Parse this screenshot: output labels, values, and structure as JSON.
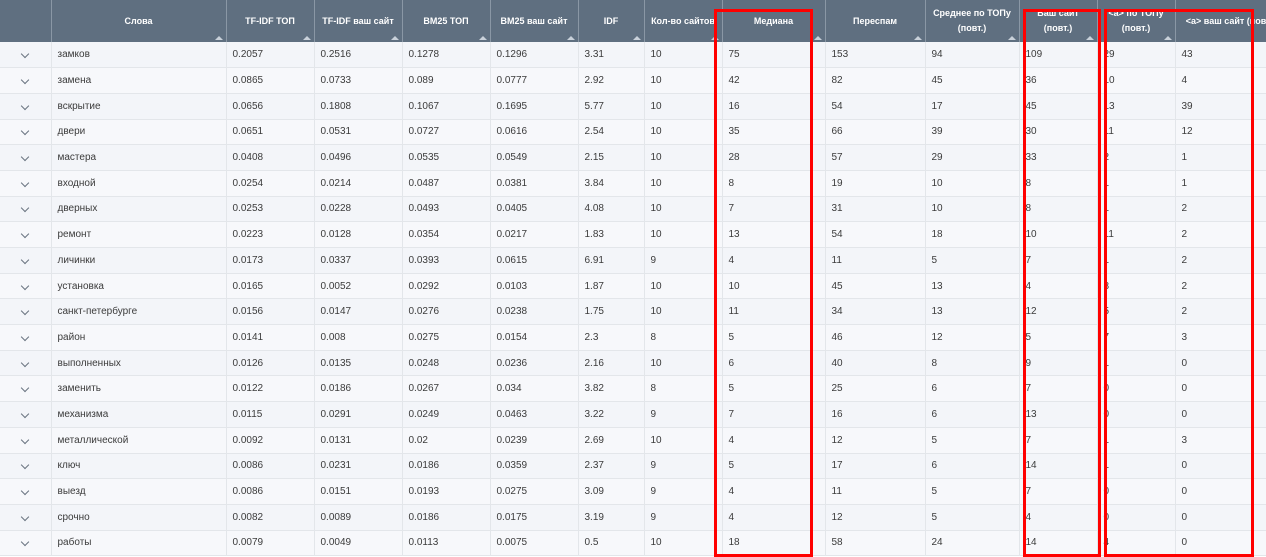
{
  "columns": [
    "",
    "Слова",
    "TF-IDF ТОП",
    "TF-IDF ваш сайт",
    "BM25 ТОП",
    "BM25 ваш сайт",
    "IDF",
    "Кол-во сайтов",
    "Медиана",
    "Переспам",
    "Среднее по ТОПу (повт.)",
    "Ваш сайт (повт.)",
    "<a> по ТОПу (повт.)",
    "<a> ваш сайт (повт.)"
  ],
  "rows": [
    [
      "замков",
      "0.2057",
      "0.2516",
      "0.1278",
      "0.1296",
      "3.31",
      "10",
      "75",
      "153",
      "94",
      "109",
      "29",
      "43"
    ],
    [
      "замена",
      "0.0865",
      "0.0733",
      "0.089",
      "0.0777",
      "2.92",
      "10",
      "42",
      "82",
      "45",
      "36",
      "10",
      "4"
    ],
    [
      "вскрытие",
      "0.0656",
      "0.1808",
      "0.1067",
      "0.1695",
      "5.77",
      "10",
      "16",
      "54",
      "17",
      "45",
      "13",
      "39"
    ],
    [
      "двери",
      "0.0651",
      "0.0531",
      "0.0727",
      "0.0616",
      "2.54",
      "10",
      "35",
      "66",
      "39",
      "30",
      "11",
      "12"
    ],
    [
      "мастера",
      "0.0408",
      "0.0496",
      "0.0535",
      "0.0549",
      "2.15",
      "10",
      "28",
      "57",
      "29",
      "33",
      "2",
      "1"
    ],
    [
      "входной",
      "0.0254",
      "0.0214",
      "0.0487",
      "0.0381",
      "3.84",
      "10",
      "8",
      "19",
      "10",
      "8",
      "1",
      "1"
    ],
    [
      "дверных",
      "0.0253",
      "0.0228",
      "0.0493",
      "0.0405",
      "4.08",
      "10",
      "7",
      "31",
      "10",
      "8",
      "1",
      "2"
    ],
    [
      "ремонт",
      "0.0223",
      "0.0128",
      "0.0354",
      "0.0217",
      "1.83",
      "10",
      "13",
      "54",
      "18",
      "10",
      "11",
      "2"
    ],
    [
      "личинки",
      "0.0173",
      "0.0337",
      "0.0393",
      "0.0615",
      "6.91",
      "9",
      "4",
      "11",
      "5",
      "7",
      "1",
      "2"
    ],
    [
      "установка",
      "0.0165",
      "0.0052",
      "0.0292",
      "0.0103",
      "1.87",
      "10",
      "10",
      "45",
      "13",
      "4",
      "8",
      "2"
    ],
    [
      "санкт-петербурге",
      "0.0156",
      "0.0147",
      "0.0276",
      "0.0238",
      "1.75",
      "10",
      "11",
      "34",
      "13",
      "12",
      "5",
      "2"
    ],
    [
      "район",
      "0.0141",
      "0.008",
      "0.0275",
      "0.0154",
      "2.3",
      "8",
      "5",
      "46",
      "12",
      "5",
      "7",
      "3"
    ],
    [
      "выполненных",
      "0.0126",
      "0.0135",
      "0.0248",
      "0.0236",
      "2.16",
      "10",
      "6",
      "40",
      "8",
      "9",
      "1",
      "0"
    ],
    [
      "заменить",
      "0.0122",
      "0.0186",
      "0.0267",
      "0.034",
      "3.82",
      "8",
      "5",
      "25",
      "6",
      "7",
      "0",
      "0"
    ],
    [
      "механизма",
      "0.0115",
      "0.0291",
      "0.0249",
      "0.0463",
      "3.22",
      "9",
      "7",
      "16",
      "6",
      "13",
      "0",
      "0"
    ],
    [
      "металлической",
      "0.0092",
      "0.0131",
      "0.02",
      "0.0239",
      "2.69",
      "10",
      "4",
      "12",
      "5",
      "7",
      "1",
      "3"
    ],
    [
      "ключ",
      "0.0086",
      "0.0231",
      "0.0186",
      "0.0359",
      "2.37",
      "9",
      "5",
      "17",
      "6",
      "14",
      "1",
      "0"
    ],
    [
      "выезд",
      "0.0086",
      "0.0151",
      "0.0193",
      "0.0275",
      "3.09",
      "9",
      "4",
      "11",
      "5",
      "7",
      "0",
      "0"
    ],
    [
      "срочно",
      "0.0082",
      "0.0089",
      "0.0186",
      "0.0175",
      "3.19",
      "9",
      "4",
      "12",
      "5",
      "4",
      "0",
      "0"
    ],
    [
      "работы",
      "0.0079",
      "0.0049",
      "0.0113",
      "0.0075",
      "0.5",
      "10",
      "18",
      "58",
      "24",
      "14",
      "4",
      "0"
    ]
  ],
  "colors": {
    "header_bg": "#5f6f80",
    "highlight": "#ff0000"
  }
}
